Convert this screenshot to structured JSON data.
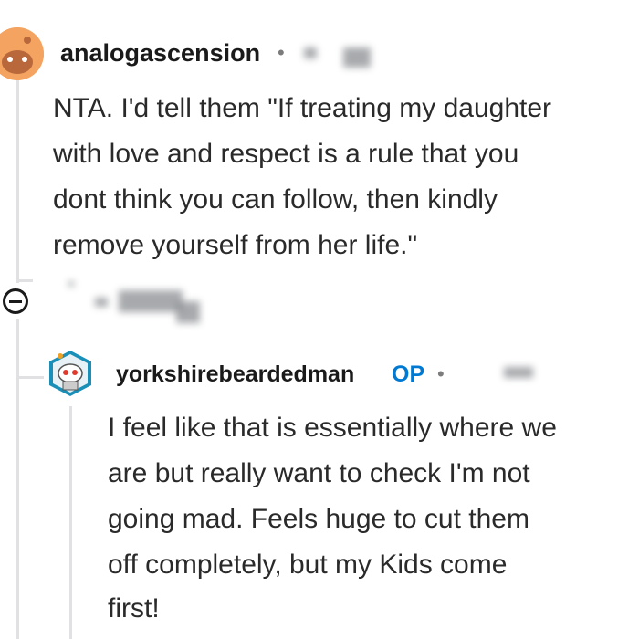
{
  "comment_1": {
    "username": "analogascension",
    "separator": "•",
    "body_lines": [
      "NTA. I'd tell them \"If treating my daughter",
      "with love and respect is a rule that you",
      "dont think you can follow, then kindly",
      "remove yourself from her life.\""
    ],
    "avatar_icon": "snoo-avatar-icon",
    "avatar_color": "#f4a460"
  },
  "reply": {
    "username": "yorkshirebeardedman",
    "op_badge": "OP",
    "separator": "•",
    "body_lines": [
      "I feel like that is essentially where we",
      "are but really want to check I'm not",
      "going mad. Feels huge to cut them",
      "off completely, but my Kids come",
      "first!"
    ],
    "avatar_icon": "snoo-robot-avatar-icon",
    "op_color": "#0079d3"
  },
  "controls": {
    "collapse_icon": "collapse-minus-icon"
  }
}
